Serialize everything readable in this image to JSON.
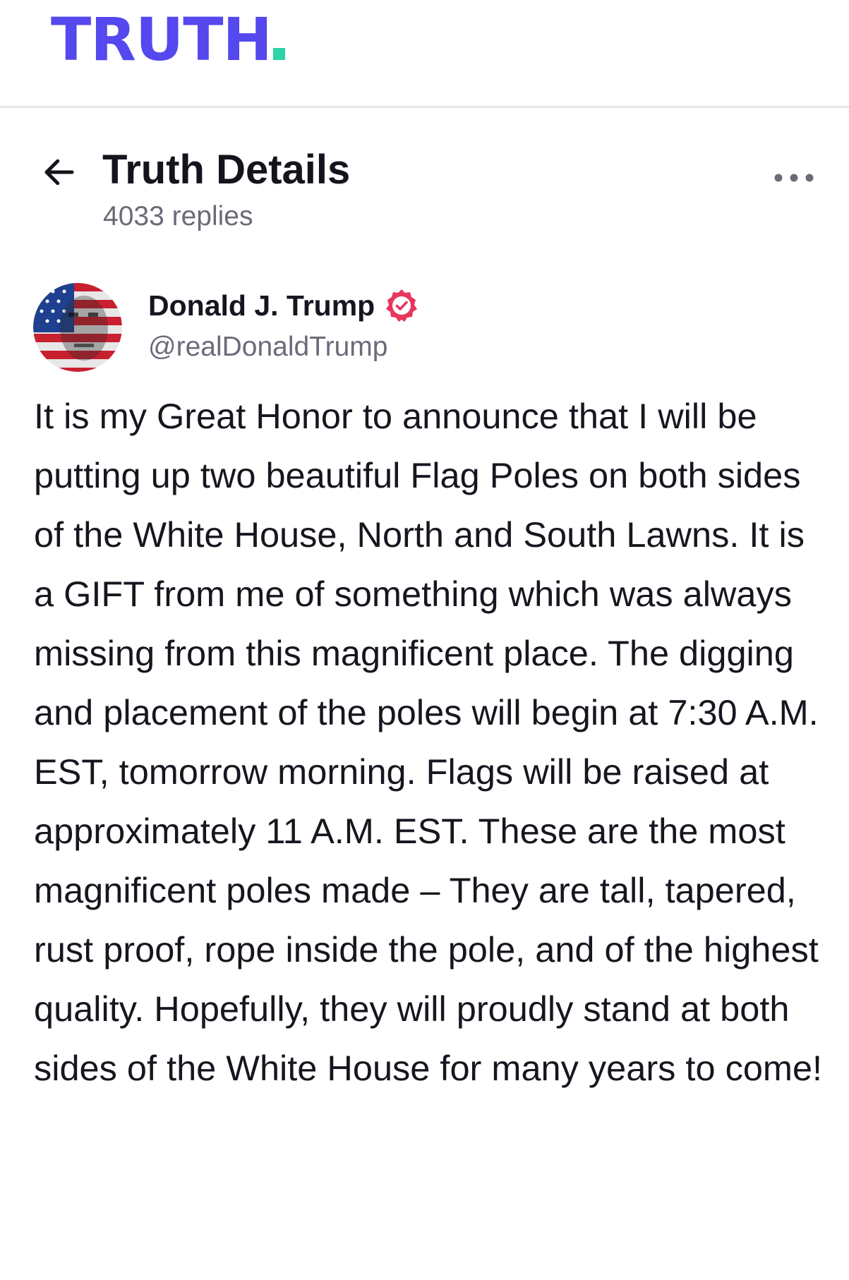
{
  "app": {
    "logo_text": "TRUTH",
    "brand_color": "#5448ee",
    "accent_color": "#2dd4a8"
  },
  "header": {
    "title": "Truth Details",
    "replies": "4033 replies",
    "back_icon": "arrow-left-icon",
    "more_icon": "more-horizontal-icon"
  },
  "post": {
    "author_name": "Donald J. Trump",
    "author_handle": "@realDonaldTrump",
    "verified_color": "#e8365d",
    "body": "It is my Great Honor to announce that I will be putting up two beautiful Flag Poles on both sides of the White House, North and South Lawns. It is a GIFT from me of something which was always missing from this magnificent place. The digging and placement of the poles will begin at 7:30 A.M. EST, tomorrow morning. Flags will be raised at approximately 11 A.M. EST. These are the most magnificent poles made – They are tall, tapered, rust proof, rope inside the pole, and of the highest quality. Hopefully, they will proudly stand at both sides of the White House for many years to come!"
  }
}
